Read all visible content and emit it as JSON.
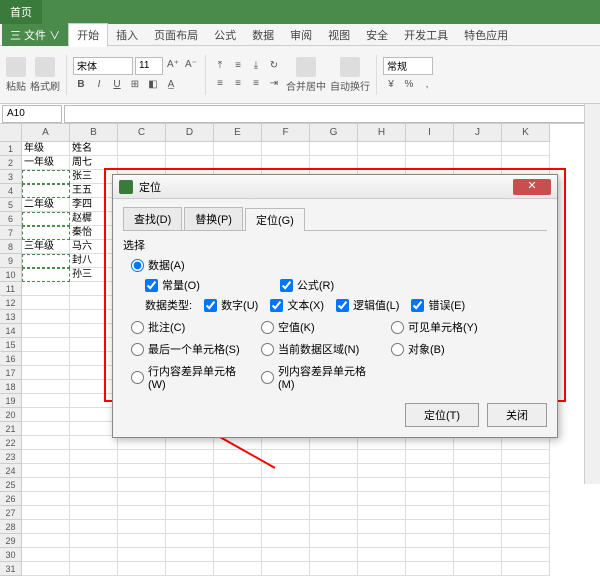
{
  "titlebar": {
    "tabs": [
      "首页"
    ]
  },
  "ribbon_tabs": {
    "file": "三 文件 ∨",
    "items": [
      "开始",
      "插入",
      "页面布局",
      "公式",
      "数据",
      "审阅",
      "视图",
      "安全",
      "开发工具",
      "特色应用"
    ],
    "active_index": 0
  },
  "ribbon": {
    "paste": "粘贴",
    "format_painter": "格式刷",
    "font_name": "宋体",
    "font_size": "11",
    "merge_center": "合并居中",
    "wrap_text": "自动换行",
    "number_format": "常规"
  },
  "name_box": "A10",
  "columns": [
    "A",
    "B",
    "C",
    "D",
    "E",
    "F",
    "G",
    "H",
    "I",
    "J",
    "K"
  ],
  "row_count": 31,
  "cells": {
    "A1": "年级",
    "B1": "姓名",
    "A2": "一年级",
    "B2": "周七",
    "B3": "张三",
    "B4": "王五",
    "A5": "二年级",
    "B5": "李四",
    "B6": "赵樨",
    "B7": "秦怡",
    "A8": "三年级",
    "B8": "马六",
    "B9": "封八",
    "B10": "孙三"
  },
  "selected_blanks": [
    "A3",
    "A4",
    "A6",
    "A7",
    "A9",
    "A10"
  ],
  "dialog": {
    "title": "定位",
    "tabs": [
      {
        "label": "查找(D)",
        "active": false
      },
      {
        "label": "替换(P)",
        "active": false
      },
      {
        "label": "定位(G)",
        "active": true
      }
    ],
    "section": "选择",
    "opts": {
      "data": {
        "label": "数据(A)",
        "type": "radio",
        "checked": true
      },
      "const": {
        "label": "常量(O)",
        "type": "check",
        "checked": true
      },
      "formula": {
        "label": "公式(R)",
        "type": "check",
        "checked": true
      },
      "dtype_label": "数据类型:",
      "num": {
        "label": "数字(U)",
        "type": "check",
        "checked": true
      },
      "text": {
        "label": "文本(X)",
        "type": "check",
        "checked": true
      },
      "logic": {
        "label": "逻辑值(L)",
        "type": "check",
        "checked": true
      },
      "err": {
        "label": "错误(E)",
        "type": "check",
        "checked": true
      },
      "comment": {
        "label": "批注(C)",
        "type": "radio",
        "checked": false
      },
      "blank": {
        "label": "空值(K)",
        "type": "radio",
        "checked": false
      },
      "visible": {
        "label": "可见单元格(Y)",
        "type": "radio",
        "checked": false
      },
      "last": {
        "label": "最后一个单元格(S)",
        "type": "radio",
        "checked": false
      },
      "region": {
        "label": "当前数据区域(N)",
        "type": "radio",
        "checked": false
      },
      "objects": {
        "label": "对象(B)",
        "type": "radio",
        "checked": false
      },
      "rowdiff": {
        "label": "行内容差异单元格(W)",
        "type": "radio",
        "checked": false
      },
      "coldiff": {
        "label": "列内容差异单元格(M)",
        "type": "radio",
        "checked": false
      }
    },
    "buttons": {
      "ok": "定位(T)",
      "close": "关闭"
    }
  }
}
